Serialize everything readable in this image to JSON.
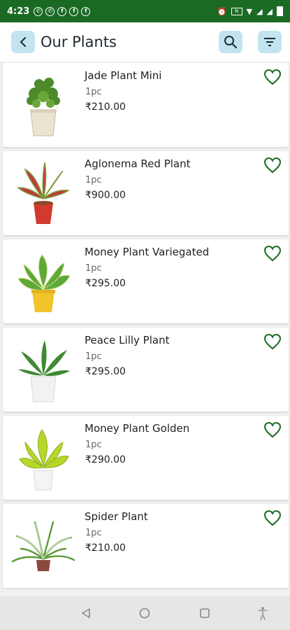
{
  "status_bar": {
    "time": "4:23"
  },
  "header": {
    "title": "Our Plants"
  },
  "products": [
    {
      "name": "Jade Plant Mini",
      "qty": "1pc",
      "price": "₹210.00"
    },
    {
      "name": "Aglonema Red Plant",
      "qty": "1pc",
      "price": "₹900.00"
    },
    {
      "name": "Money Plant Variegated",
      "qty": "1pc",
      "price": "₹295.00"
    },
    {
      "name": "Peace Lilly Plant",
      "qty": "1pc",
      "price": "₹295.00"
    },
    {
      "name": "Money Plant Golden",
      "qty": "1pc",
      "price": "₹290.00"
    },
    {
      "name": "Spider Plant",
      "qty": "1pc",
      "price": "₹210.00"
    }
  ],
  "colors": {
    "status_bar": "#1b6a24",
    "accent_button": "#c2e4f0",
    "heart": "#1b6a24"
  },
  "icons": [
    "back-icon",
    "search-icon",
    "filter-icon",
    "heart-icon"
  ]
}
